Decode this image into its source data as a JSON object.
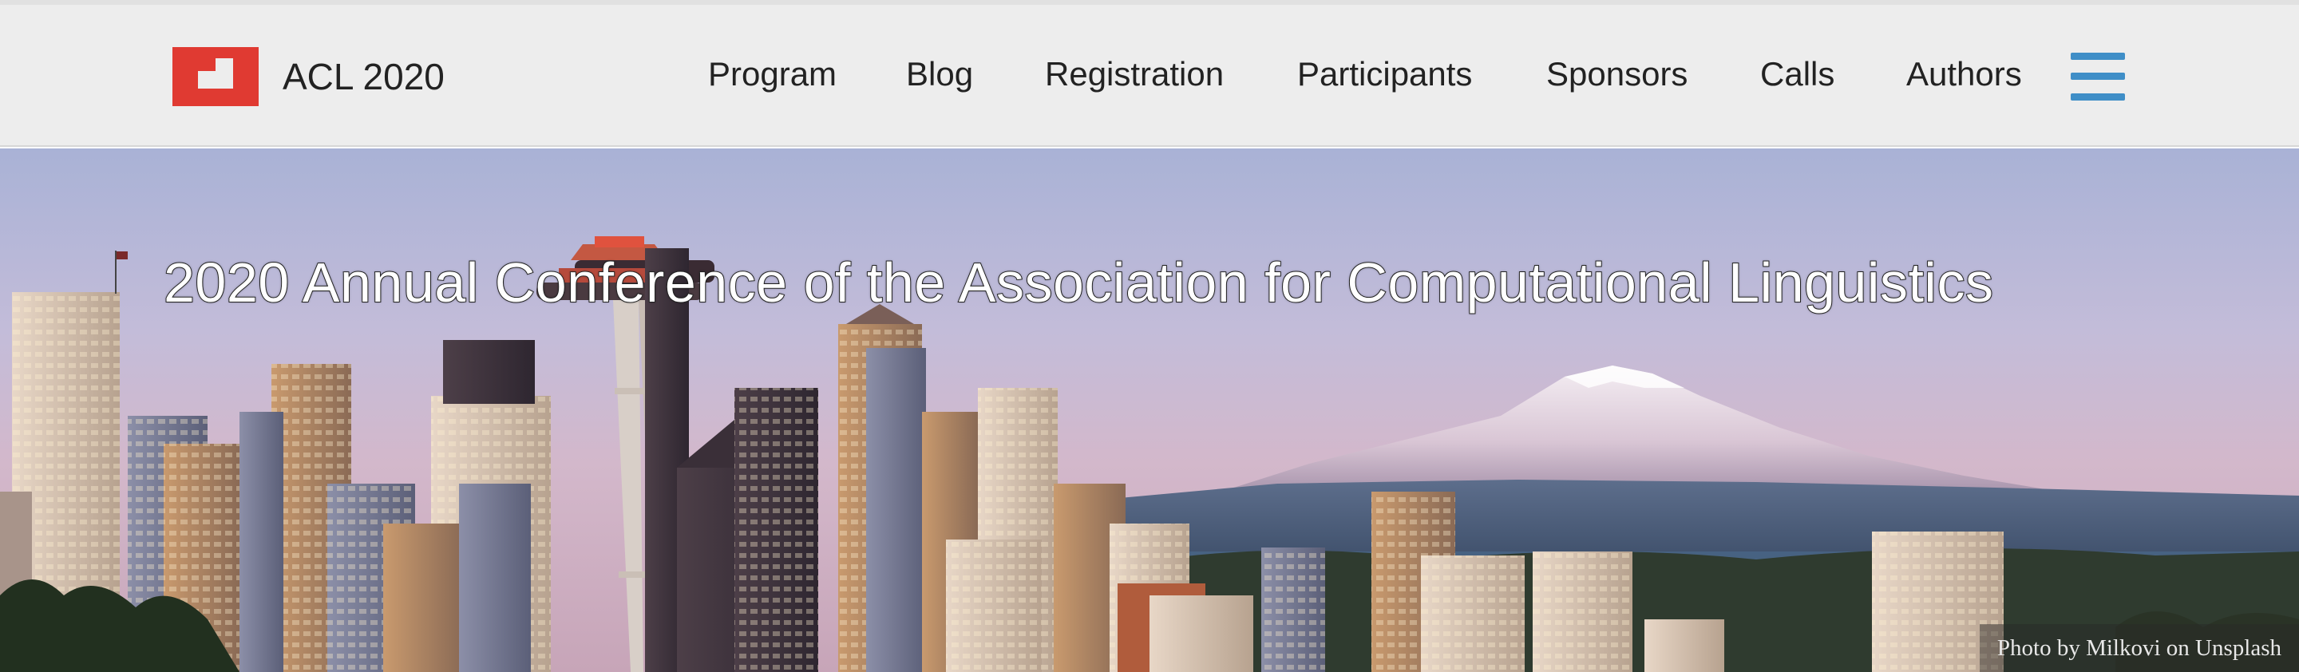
{
  "header": {
    "brand": {
      "logo_icon": "acl-logo-icon",
      "title": "ACL 2020",
      "logo_color": "#e03a32"
    },
    "nav": {
      "items": [
        {
          "label": "Program"
        },
        {
          "label": "Blog"
        },
        {
          "label": "Registration"
        },
        {
          "label": "Participants"
        },
        {
          "label": "Sponsors"
        },
        {
          "label": "Calls"
        },
        {
          "label": "Authors"
        }
      ],
      "menu_icon": "hamburger-menu-icon",
      "menu_icon_color": "#3f8ec7"
    }
  },
  "hero": {
    "title": "2020 Annual Conference of the Association for Computational Linguistics",
    "photo_credit": "Photo by Milkovi on Unsplash",
    "image": "seattle-skyline-with-mount-rainier"
  }
}
